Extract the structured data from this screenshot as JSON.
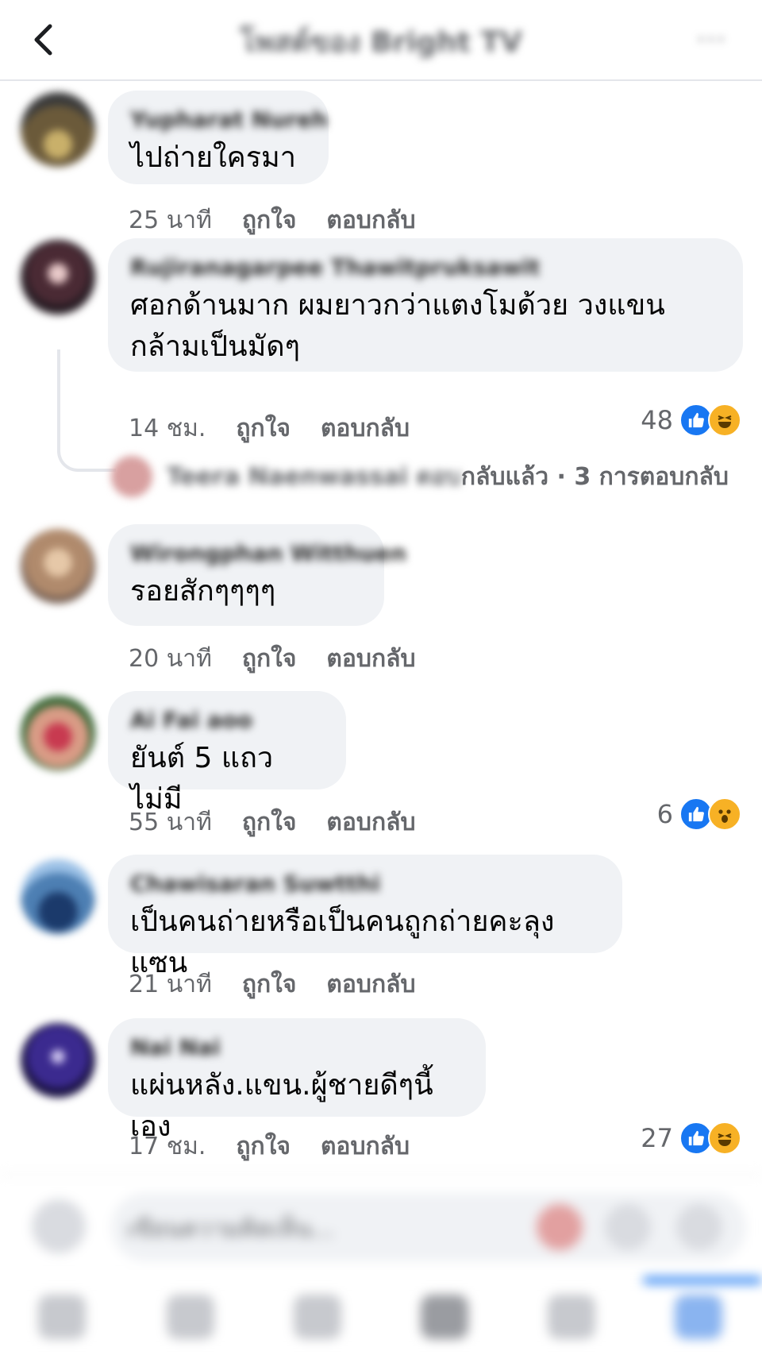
{
  "header": {
    "title": "โพสต์ของ Bright TV",
    "more": "···"
  },
  "comments": [
    {
      "author": "Yupharat Nureh",
      "text": "ไปถ่ายใครมา",
      "time": "25 นาที",
      "like": "ถูกใจ",
      "reply": "ตอบกลับ",
      "reactions": ""
    },
    {
      "author": "Rujiranagarpee Thawitpruksawit",
      "text": "ศอกด้านมาก ผมยาวกว่าแตงโมด้วย วงแขนกล้ามเป็นมัดๆ",
      "time": "14 ชม.",
      "like": "ถูกใจ",
      "reply": "ตอบกลับ",
      "reactions": "48"
    },
    {
      "author": "Wirongphan Witthuen",
      "text": "รอยสักๆๆๆๆ",
      "time": "20 นาที",
      "like": "ถูกใจ",
      "reply": "ตอบกลับ",
      "reactions": ""
    },
    {
      "author": "Ai Fai aoo",
      "text": "ยันต์ 5 แถว ไม่มี",
      "time": "55 นาที",
      "like": "ถูกใจ",
      "reply": "ตอบกลับ",
      "reactions": "6"
    },
    {
      "author": "Chawisaran Suwtthi",
      "text": "เป็นคนถ่ายหรือเป็นคนถูกถ่ายคะลุงแซน",
      "time": "21 นาที",
      "like": "ถูกใจ",
      "reply": "ตอบกลับ",
      "reactions": ""
    },
    {
      "author": "Nai Nai",
      "text": "แผ่นหลัง.แขน.ผู้ชายดีๆนี้เอง",
      "time": "17 ชม.",
      "like": "ถูกใจ",
      "reply": "ตอบกลับ",
      "reactions": "27"
    }
  ],
  "reply_summary": {
    "name": "Teera Naenwassai ตอบ",
    "text": "กลับแล้ว · 3 การตอบกลับ"
  },
  "composer": {
    "placeholder": "เขียนความคิดเห็น..."
  },
  "icons": {
    "back": "chevron-left-icon",
    "like": "thumbs-up-icon",
    "laugh": "laugh-face-icon",
    "wow": "wow-face-icon"
  },
  "colors": {
    "accent": "#1877f2",
    "bubble": "#f0f2f5",
    "muted": "#65676b"
  }
}
